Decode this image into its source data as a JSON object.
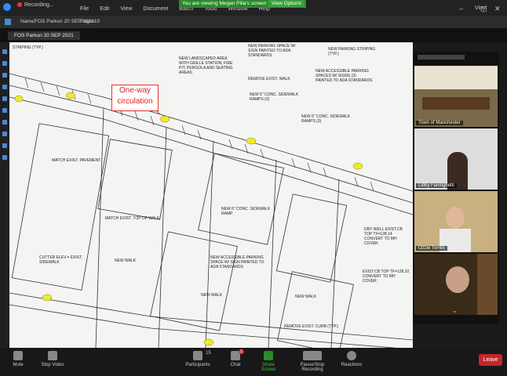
{
  "recording": "Recording...",
  "menu": [
    "File",
    "Edit",
    "View",
    "Document",
    "Batch",
    "Tools",
    "Window",
    "Help"
  ],
  "banner": {
    "text": "You are viewing Megan Pilla's screen",
    "view_options": "View Options"
  },
  "vinyl_label": "Vinyl",
  "doc_toolbar": {
    "name_label": "Name:",
    "name_value": "FOS Parkon 20 SEP 2021",
    "pages_label": "Pages:",
    "pages_value": "10"
  },
  "tab": {
    "label": "FOS Parkon 20 SEP 2021"
  },
  "drawing": {
    "callout": "One-way circulation",
    "captions": [
      "STRIPING (TYP.)",
      "NEW LANDSCAPED AREA WITH GRILLE STATION, FIRE PIT, PERGOLA AND SEATING AREAS",
      "NEW PARKING SPACE W/ SIGN PAINTED TO ADA STANDARDS",
      "REMOVE EXIST. WALK",
      "NEW 6\" CONC. SIDEWALK RAMPS (2)",
      "NEW PARKING STRIPING (TYP.)",
      "NEW ACCESSIBLE PARKING SPACES W/ SIGNS (3) PAINTED TO ADA STANDARDS",
      "NEW 6\" CONC. SIDEWALK RAMPS (3)",
      "MATCH EXIST. PAVEMENT",
      "NEW 6\" CONC. SIDEWALK RAMP",
      "MATCH EXIST. TOP OF WALK",
      "NEW WALK",
      "NEW ACCESSIBLE PARKING SPACE W/ SIGN PAINTED TO ADA STANDARDS",
      "CUTTER ELEV.= EXIST. SIDEWALK",
      "DRY WELL EXIST.CB TOP TF=128.14 CONVERT TO MH COVER",
      "EXIST.CB TOP TF=128.32 CONVERT TO MH COVER",
      "NEW WALK",
      "REMOVE EXIST. CURB (TYP.)",
      "NEW WALK"
    ]
  },
  "participants": [
    {
      "name": "Town of Manchester"
    },
    {
      "name": "Libby Faninghetti"
    },
    {
      "name": "Ozzie Torres"
    },
    {
      "name": ""
    }
  ],
  "bottom": {
    "mute": "Mute",
    "stop_video": "Stop Video",
    "participants": "Participants",
    "participants_count": "15",
    "chat": "Chat",
    "chat_badge": "1",
    "share": "Share Screen",
    "record": "Pause/Stop Recording",
    "reactions": "Reactions",
    "leave": "Leave"
  },
  "colors": {
    "accent_green": "#2a8a2a",
    "leave_red": "#c1272d",
    "highlight_yellow": "#f2ea20",
    "callout_red": "#d33"
  }
}
